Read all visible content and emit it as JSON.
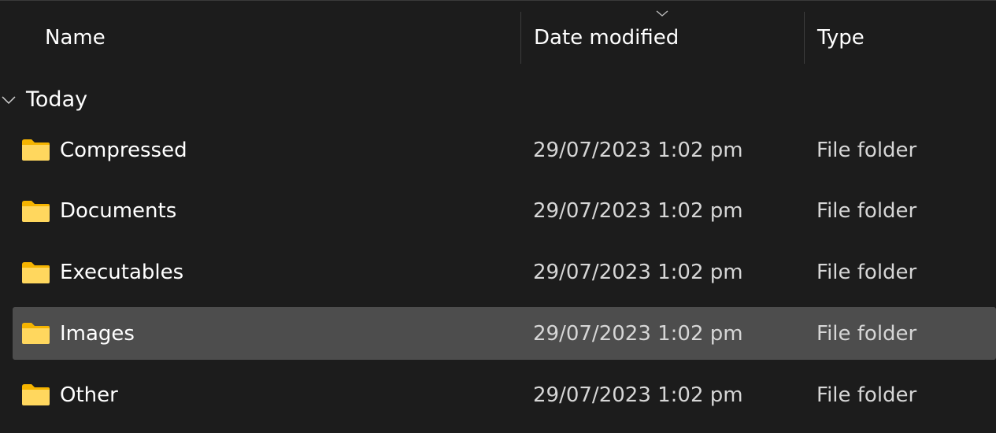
{
  "columns": {
    "name": "Name",
    "date_modified": "Date modified",
    "type": "Type",
    "sort_indicator_icon": "chevron-down-icon"
  },
  "group": {
    "label": "Today",
    "expanded": true,
    "chevron_icon": "chevron-down-icon"
  },
  "rows": [
    {
      "name": "Compressed",
      "date": "29/07/2023 1:02 pm",
      "type": "File folder",
      "icon": "folder-icon",
      "selected": false
    },
    {
      "name": "Documents",
      "date": "29/07/2023 1:02 pm",
      "type": "File folder",
      "icon": "folder-icon",
      "selected": false
    },
    {
      "name": "Executables",
      "date": "29/07/2023 1:02 pm",
      "type": "File folder",
      "icon": "folder-icon",
      "selected": false
    },
    {
      "name": "Images",
      "date": "29/07/2023 1:02 pm",
      "type": "File folder",
      "icon": "folder-icon",
      "selected": true
    },
    {
      "name": "Other",
      "date": "29/07/2023 1:02 pm",
      "type": "File folder",
      "icon": "folder-icon",
      "selected": false
    }
  ],
  "colors": {
    "background": "#1c1c1c",
    "selected_row": "#4d4d4d",
    "folder_body": "#ffd75e",
    "folder_tab": "#f5b400",
    "secondary_text": "#d6d6d6"
  }
}
